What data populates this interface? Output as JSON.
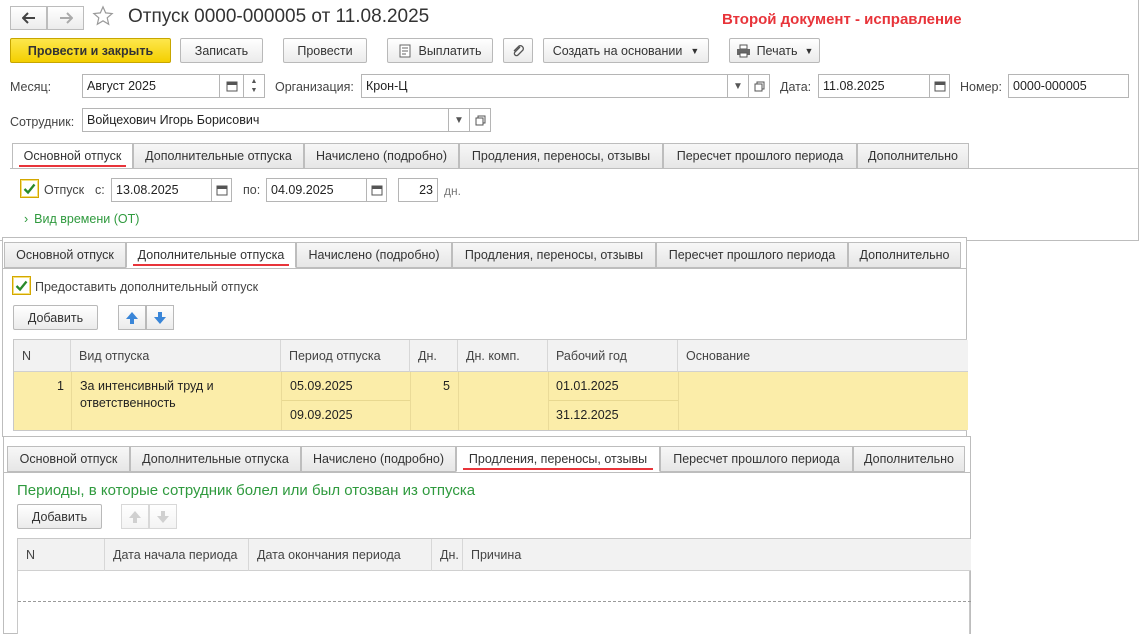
{
  "window": {
    "title": "Отпуск 0000-000005 от 11.08.2025",
    "annotation": "Второй документ - исправление",
    "annotation_color": "#e8343a"
  },
  "nav": {
    "back_icon": "arrow-left-icon",
    "forward_icon": "arrow-right-icon",
    "favorite_icon": "star-icon"
  },
  "toolbar": {
    "post_close": "Провести и закрыть",
    "save": "Записать",
    "post": "Провести",
    "pay": "Выплатить",
    "create_based": "Создать на основании",
    "print": "Печать"
  },
  "header": {
    "month_label": "Месяц:",
    "month_value": "Август 2025",
    "org_label": "Организация:",
    "org_value": "Крон-Ц",
    "date_label": "Дата:",
    "date_value": "11.08.2025",
    "number_label": "Номер:",
    "number_value": "0000-000005",
    "employee_label": "Сотрудник:",
    "employee_value": "Войцехович Игорь Борисович"
  },
  "tabs": [
    "Основной отпуск",
    "Дополнительные отпуска",
    "Начислено (подробно)",
    "Продления, переносы, отзывы",
    "Пересчет прошлого периода",
    "Дополнительно"
  ],
  "main_tab": {
    "vacation_label": "Отпуск",
    "from_label": "с:",
    "from_value": "13.08.2025",
    "to_label": "по:",
    "to_value": "04.09.2025",
    "days_value": "23",
    "days_label": "дн.",
    "time_kind": "Вид времени (ОТ)"
  },
  "additional_tab": {
    "provide_label": "Предоставить дополнительный отпуск",
    "add_button": "Добавить",
    "columns": [
      "N",
      "Вид отпуска",
      "Период отпуска",
      "Дн.",
      "Дн. комп.",
      "Рабочий год",
      "Основание"
    ],
    "row": {
      "n": "1",
      "kind_line1": "За интенсивный труд и",
      "kind_line2": "ответственность",
      "period_from": "05.09.2025",
      "period_to": "09.09.2025",
      "days": "5",
      "days_comp": "",
      "year_from": "01.01.2025",
      "year_to": "31.12.2025",
      "basis": ""
    }
  },
  "extensions_tab": {
    "heading": "Периоды, в которые сотрудник болел или был отозван из отпуска",
    "heading_color": "#2f9a3e",
    "add_button": "Добавить",
    "columns": [
      "N",
      "Дата начала периода",
      "Дата окончания периода",
      "Дн.",
      "Причина"
    ]
  }
}
